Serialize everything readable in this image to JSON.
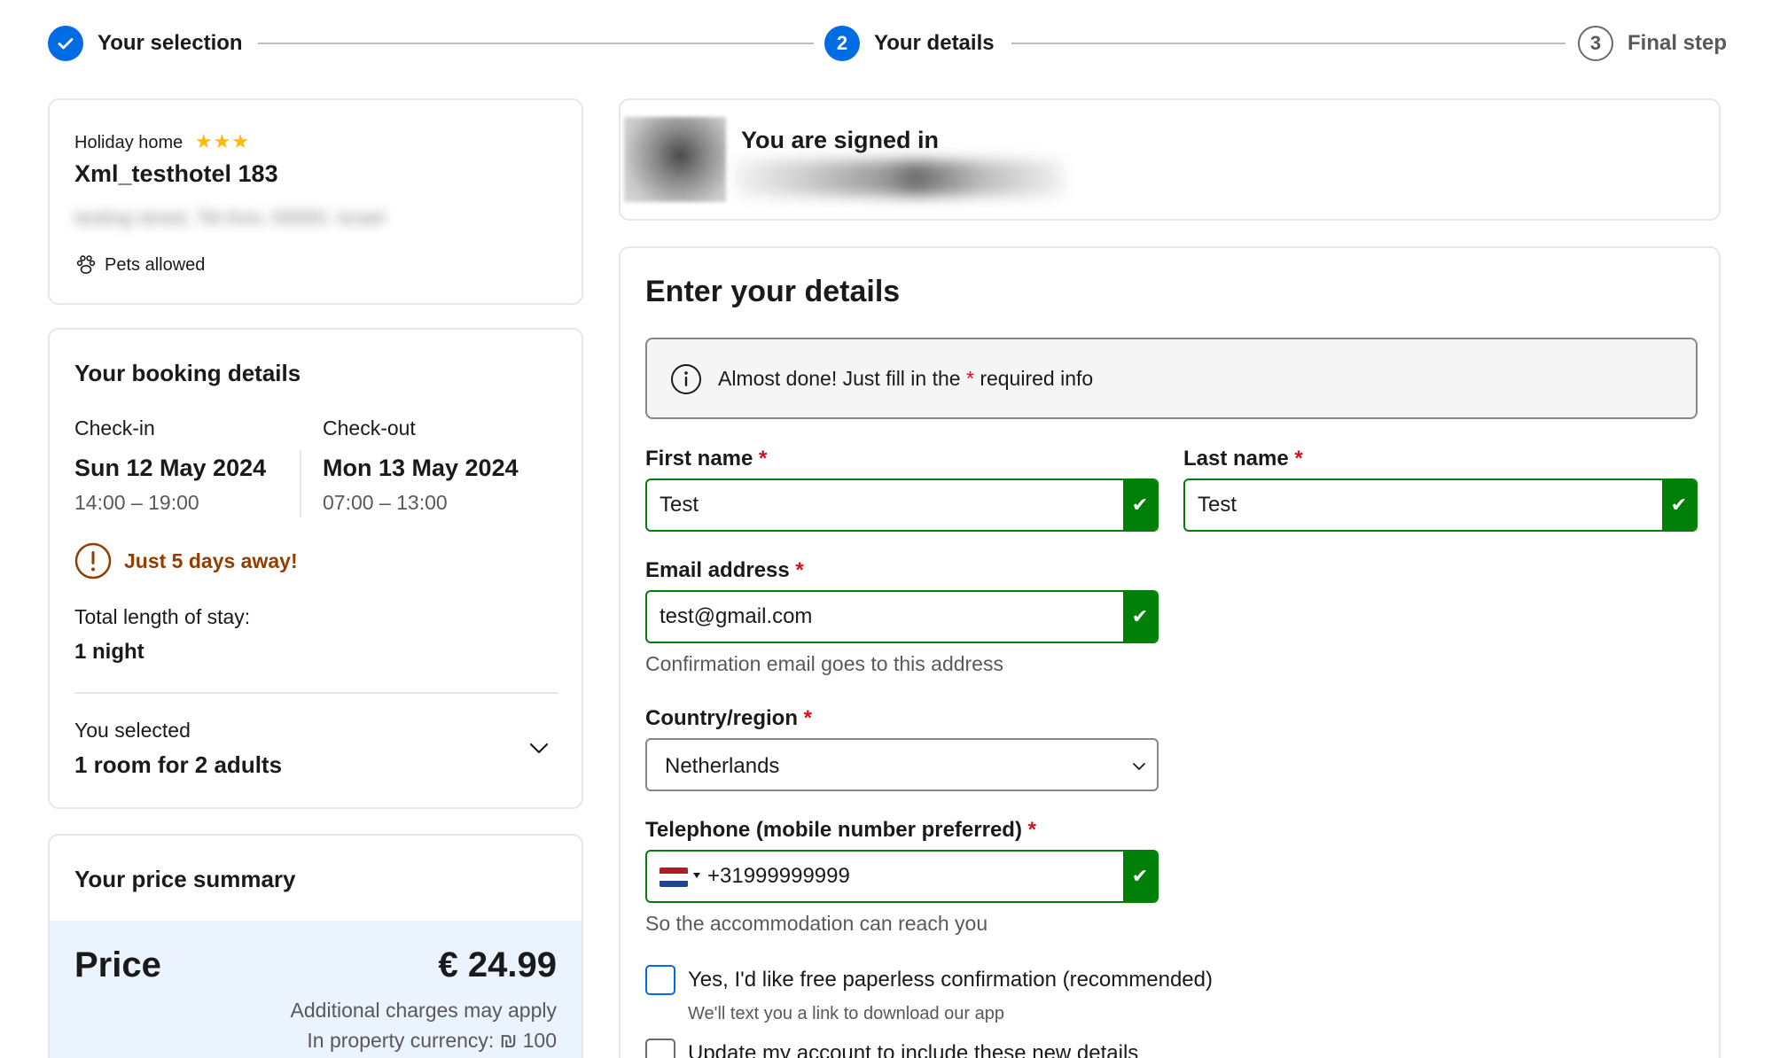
{
  "stepper": {
    "steps": [
      {
        "label": "Your selection",
        "state": "done"
      },
      {
        "label": "Your details",
        "number": "2",
        "state": "current"
      },
      {
        "label": "Final step",
        "number": "3",
        "state": "upcoming"
      }
    ]
  },
  "property": {
    "type": "Holiday home",
    "stars": "★★★",
    "name": "Xml_testhotel 183",
    "address_blurred": "testing street, Tel Aviv, 00000, Israel",
    "amenity": "Pets allowed"
  },
  "booking": {
    "title": "Your booking details",
    "checkin_label": "Check-in",
    "checkin_date": "Sun 12 May 2024",
    "checkin_time": "14:00 – 19:00",
    "checkout_label": "Check-out",
    "checkout_date": "Mon 13 May 2024",
    "checkout_time": "07:00 – 13:00",
    "urgency": "Just 5 days away!",
    "stay_label": "Total length of stay:",
    "stay_value": "1 night",
    "selected_label": "You selected",
    "selected_value": "1 room for 2 adults"
  },
  "price": {
    "title": "Your price summary",
    "label": "Price",
    "amount": "€ 24.99",
    "note1": "Additional charges may apply",
    "note2": "In property currency: ₪ 100"
  },
  "signin": {
    "title": "You are signed in"
  },
  "form": {
    "title": "Enter your details",
    "notice_prefix": "Almost done! Just fill in the",
    "notice_star": "*",
    "notice_suffix": "required info",
    "first_name_label": "First name",
    "first_name_value": "Test",
    "last_name_label": "Last name",
    "last_name_value": "Test",
    "email_label": "Email address",
    "email_value": "test@gmail.com",
    "email_hint": "Confirmation email goes to this address",
    "country_label": "Country/region",
    "country_value": "Netherlands",
    "phone_label": "Telephone (mobile number preferred)",
    "phone_value": "+31999999999",
    "phone_hint": "So the accommodation can reach you",
    "paperless_label": "Yes, I'd like free paperless confirmation (recommended)",
    "paperless_hint": "We'll text you a link to download our app",
    "update_label": "Update my account to include these new details",
    "required_mark": "*"
  },
  "colors": {
    "brand_blue": "#006ce4",
    "success_green": "#008009",
    "warning_orange": "#923e01",
    "star_yellow": "#febb02",
    "price_bg": "#ebf3ff"
  }
}
